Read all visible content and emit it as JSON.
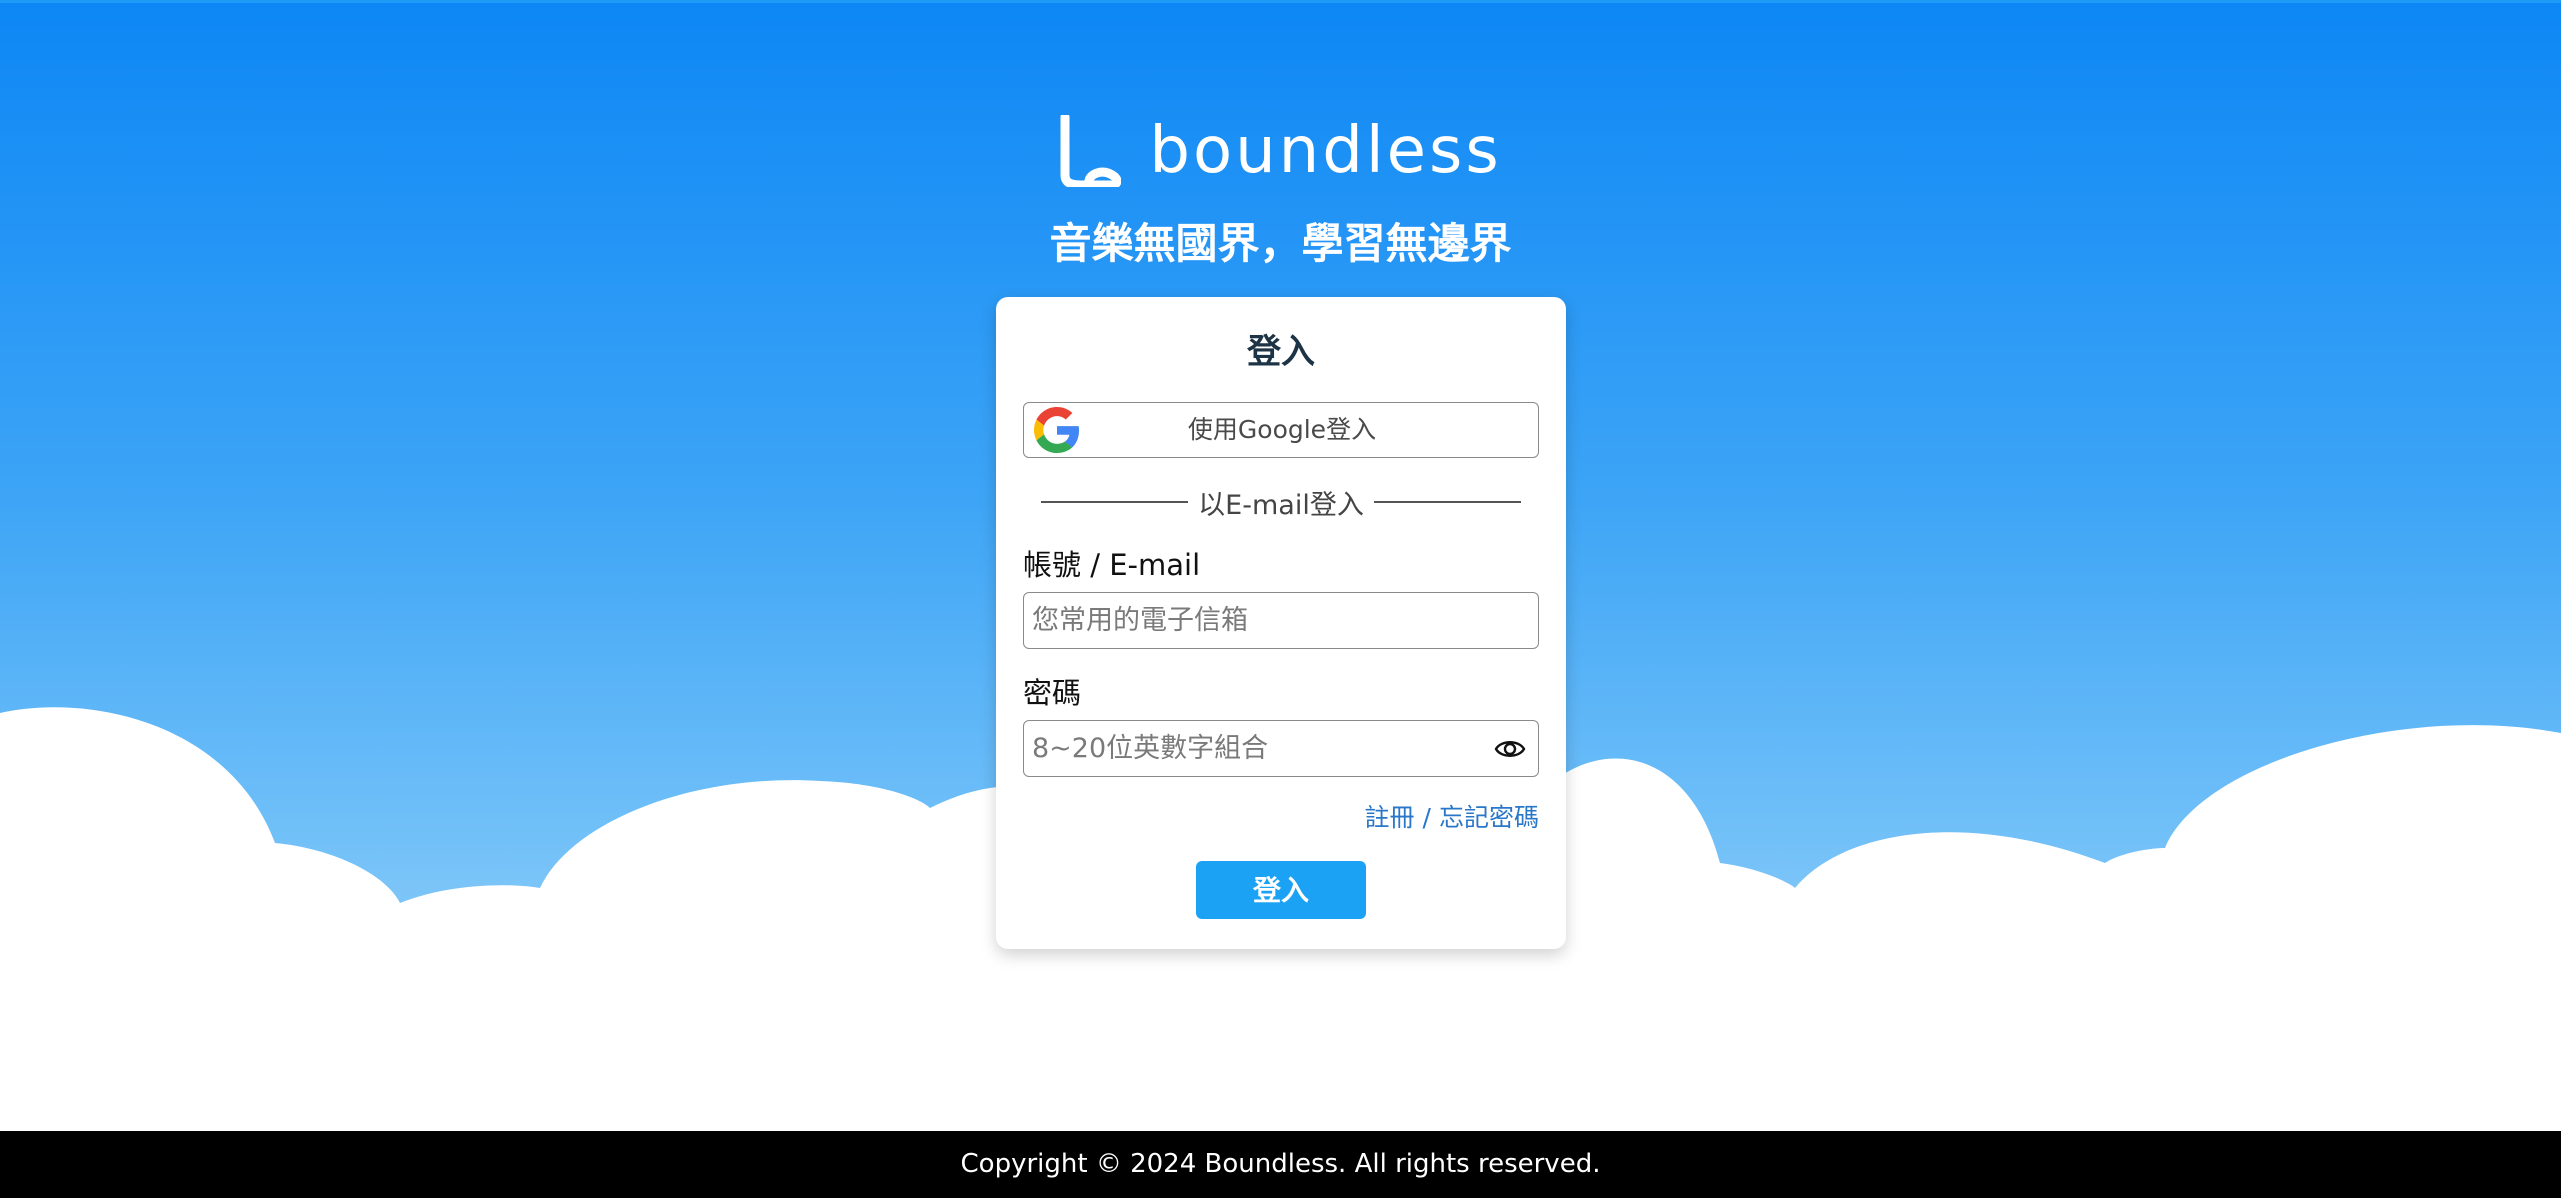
{
  "brand": {
    "name": "boundless",
    "slogan": "音樂無國界，學習無邊界",
    "logo_icon": "boundless-logo-icon"
  },
  "login": {
    "title": "登入",
    "google_button_label": "使用Google登入",
    "google_icon": "google-g-icon",
    "divider_text": "以E-mail登入",
    "email": {
      "label": "帳號 / E-mail",
      "placeholder": "您常用的電子信箱",
      "value": ""
    },
    "password": {
      "label": "密碼",
      "placeholder": "8~20位英數字組合",
      "value": "",
      "toggle_icon": "eye-icon"
    },
    "register_link": "註冊",
    "link_separator": "/",
    "forgot_link": "忘記密碼",
    "submit_label": "登入"
  },
  "footer": {
    "copyright": "Copyright © 2024 Boundless. All rights reserved."
  },
  "colors": {
    "sky_top": "#0d87f5",
    "sky_bottom": "#8fcdf9",
    "primary_button": "#1ca2f4",
    "link": "#2a77c9",
    "footer_bg": "#000000"
  }
}
